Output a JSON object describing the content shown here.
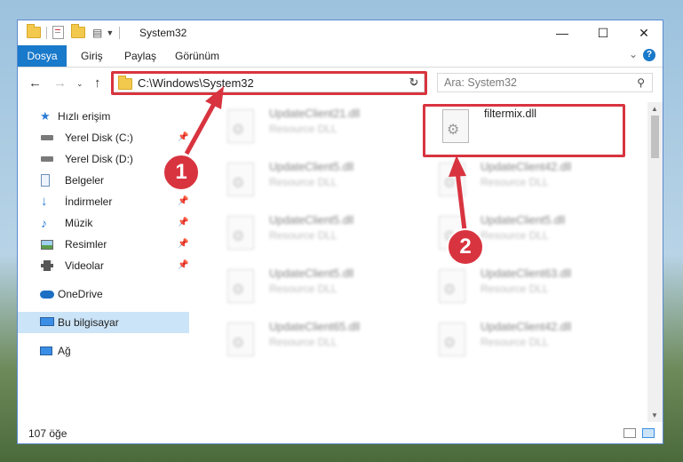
{
  "window": {
    "title": "System32",
    "minimize": "—",
    "maximize": "☐",
    "close": "✕"
  },
  "ribbon": {
    "tabs": [
      "Dosya",
      "Giriş",
      "Paylaş",
      "Görünüm"
    ],
    "help": "?"
  },
  "nav": {
    "address": "C:\\Windows\\System32",
    "search_placeholder": "Ara: System32"
  },
  "sidebar": {
    "items": [
      {
        "label": "Hızlı erişim",
        "icon": "star-icon",
        "pinned": false
      },
      {
        "label": "Yerel Disk (C:)",
        "icon": "drive-icon",
        "pinned": true
      },
      {
        "label": "Yerel Disk (D:)",
        "icon": "drive-icon",
        "pinned": false
      },
      {
        "label": "Belgeler",
        "icon": "documents-icon",
        "pinned": false
      },
      {
        "label": "İndirmeler",
        "icon": "download-icon",
        "pinned": true
      },
      {
        "label": "Müzik",
        "icon": "music-icon",
        "pinned": true
      },
      {
        "label": "Resimler",
        "icon": "pictures-icon",
        "pinned": true
      },
      {
        "label": "Videolar",
        "icon": "videos-icon",
        "pinned": true
      },
      {
        "label": "OneDrive",
        "icon": "cloud-icon",
        "pinned": false
      },
      {
        "label": "Bu bilgisayar",
        "icon": "computer-icon",
        "pinned": false,
        "selected": true
      },
      {
        "label": "Ağ",
        "icon": "network-icon",
        "pinned": false
      }
    ]
  },
  "files": [
    {
      "name": "UpdateClient21.dll",
      "type": "Resource DLL",
      "blurred": true
    },
    {
      "name": "filtermix.dll",
      "type": "",
      "blurred": false
    },
    {
      "name": "UpdateClient5.dll",
      "type": "Resource DLL",
      "blurred": true
    },
    {
      "name": "UpdateClient42.dll",
      "type": "Resource DLL",
      "blurred": true
    },
    {
      "name": "UpdateClient5.dll",
      "type": "Resource DLL",
      "blurred": true
    },
    {
      "name": "UpdateClient5.dll",
      "type": "Resource DLL",
      "blurred": true
    },
    {
      "name": "UpdateClient5.dll",
      "type": "Resource DLL",
      "blurred": true
    },
    {
      "name": "UpdateClient63.dll",
      "type": "Resource DLL",
      "blurred": true
    },
    {
      "name": "UpdateClient65.dll",
      "type": "Resource DLL",
      "blurred": true
    },
    {
      "name": "UpdateClient42.dll",
      "type": "Resource DLL",
      "blurred": true
    }
  ],
  "status": {
    "count": "107 öğe"
  },
  "callouts": [
    "1",
    "2"
  ],
  "colors": {
    "accent": "#1979ca",
    "highlight": "#d8343f",
    "selected": "#cce4f7"
  }
}
